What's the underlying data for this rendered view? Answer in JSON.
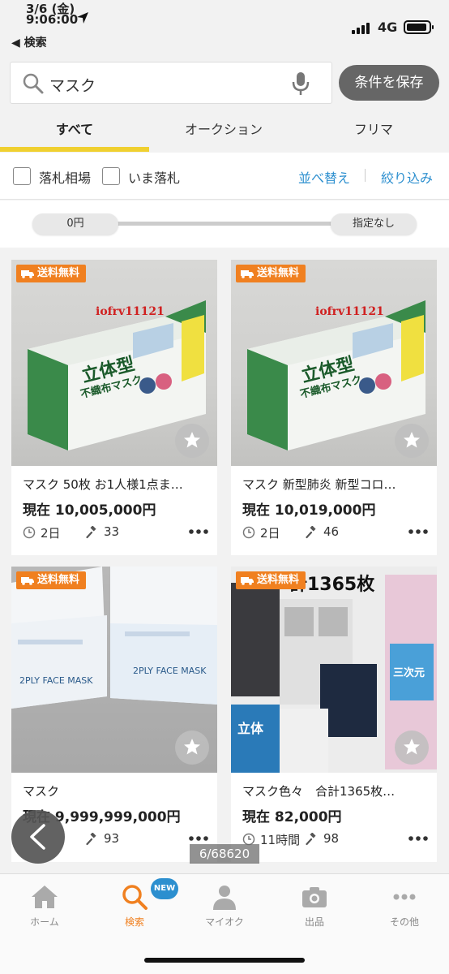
{
  "status_bar": {
    "date": "3/6 (金)",
    "time": "9:06:00",
    "back_label": "◀ 検索",
    "network": "4G"
  },
  "search": {
    "query": "マスク",
    "save_label": "条件を保存"
  },
  "tabs": [
    {
      "label": "すべて",
      "active": true
    },
    {
      "label": "オークション",
      "active": false
    },
    {
      "label": "フリマ",
      "active": false
    }
  ],
  "filters": {
    "checkbox_1": "落札相場",
    "checkbox_2": "いま落札",
    "sort_label": "並べ替え",
    "refine_label": "絞り込み"
  },
  "price_range": {
    "min_label": "0円",
    "max_label": "指定なし"
  },
  "products": [
    {
      "badge": "送料無料",
      "title": "マスク 50枚 お1人様1点ま…",
      "price": "現在 10,005,000円",
      "time_left": "2日",
      "bids": "33",
      "watermark": "iofrv11121",
      "box_text_1": "立体型",
      "box_text_2": "不織布マスク"
    },
    {
      "badge": "送料無料",
      "title": "マスク 新型肺炎 新型コロ…",
      "price": "現在 10,019,000円",
      "time_left": "2日",
      "bids": "46",
      "watermark": "iofrv11121",
      "box_text_1": "立体型",
      "box_text_2": "不織布マスク"
    },
    {
      "badge": "送料無料",
      "title": "マスク",
      "price": "現在 9,999,999,000円",
      "time_left": "",
      "bids": "93",
      "box_text_1": "2PLY FACE MASK",
      "box_text_2": "2PLY FACE MASK"
    },
    {
      "badge": "送料無料",
      "title": "マスク色々　合計1365枚…",
      "price": "現在 82,000円",
      "time_left": "11時間",
      "bids": "98",
      "overlay_text": "計1365枚",
      "box_text_1": "立体",
      "box_text_2": "三次元"
    }
  ],
  "page_counter": "6/68620",
  "tabbar": {
    "items": [
      {
        "label": "ホーム"
      },
      {
        "label": "検索"
      },
      {
        "label": "マイオク"
      },
      {
        "label": "出品"
      },
      {
        "label": "その他"
      }
    ],
    "new_badge": "NEW"
  },
  "colors": {
    "accent_yellow": "#f0d030",
    "link_blue": "#2c8fcf",
    "badge_orange": "#f08020",
    "save_button": "#666666"
  }
}
